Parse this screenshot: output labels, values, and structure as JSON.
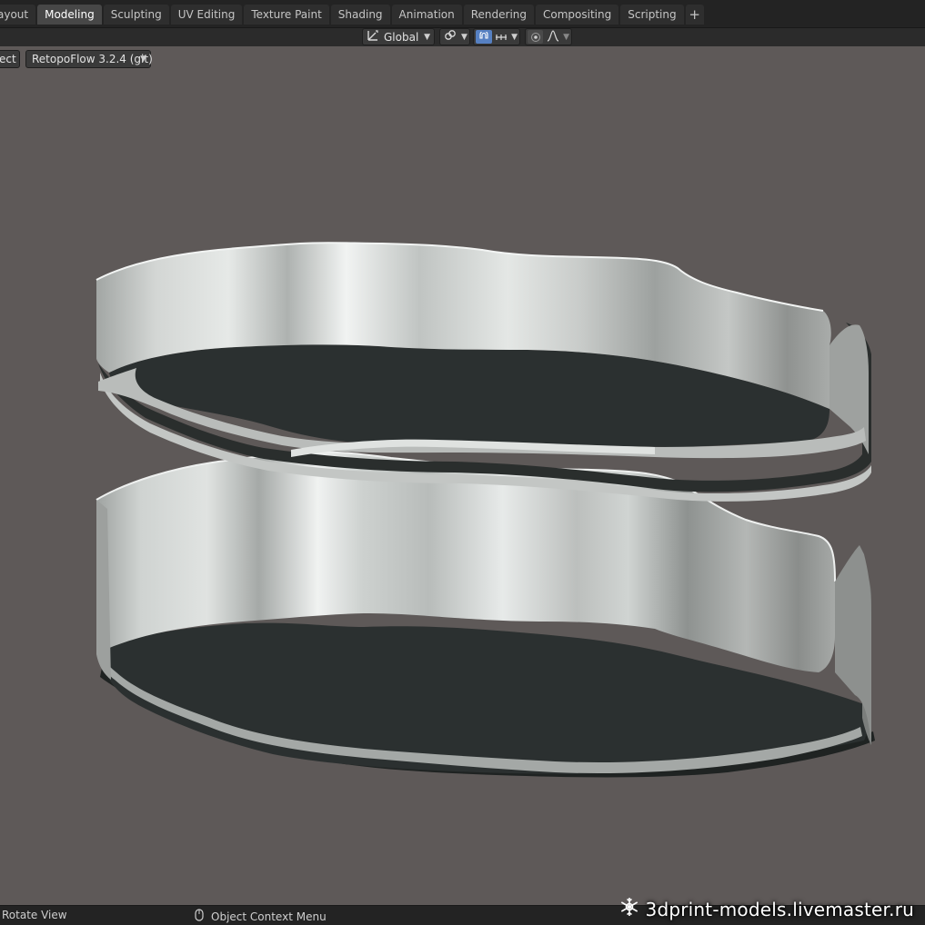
{
  "workspace_tabs": [
    {
      "label": "Layout",
      "visible": "ayout",
      "active": false
    },
    {
      "label": "Modeling",
      "active": true
    },
    {
      "label": "Sculpting",
      "active": false
    },
    {
      "label": "UV Editing",
      "active": false
    },
    {
      "label": "Texture Paint",
      "active": false
    },
    {
      "label": "Shading",
      "active": false
    },
    {
      "label": "Animation",
      "active": false
    },
    {
      "label": "Rendering",
      "active": false
    },
    {
      "label": "Compositing",
      "active": false
    },
    {
      "label": "Scripting",
      "active": false
    }
  ],
  "add_tab_label": "+",
  "viewport_header": {
    "transform_orientation": "Global",
    "pivot_icon": "link-icon",
    "snap_icon": "magnet-icon",
    "snap_target_icon": "snap-increment-icon",
    "proportional_edit_icon": "proportional-edit-icon",
    "falloff_icon": "falloff-curve-icon"
  },
  "tool_header": {
    "select_label": "ect",
    "addon_menu": "RetopoFlow 3.2.4 (git)"
  },
  "status_bar": {
    "left_hint": "Rotate View",
    "middle_hint": "Object Context Menu"
  },
  "watermark": {
    "text": "3dprint-models.livemaster.ru",
    "icon": "snowflake-logo-icon"
  },
  "viewport": {
    "subject": "two wavy ring-shaped cutter parts",
    "colors": {
      "background": "#5e5958",
      "wall": "#c4c8c6",
      "inner": "#2b3030"
    }
  }
}
